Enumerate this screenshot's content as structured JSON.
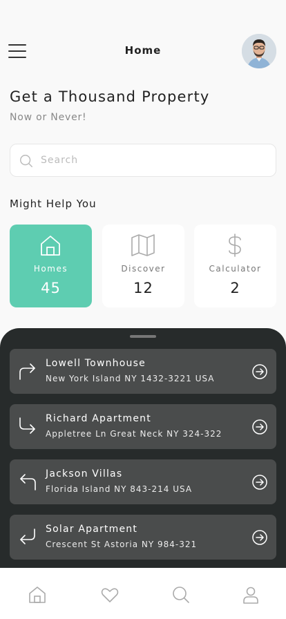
{
  "header": {
    "title": "Home",
    "menu_icon": "hamburger-icon",
    "avatar": "user-avatar"
  },
  "hero": {
    "title": "Get a Thousand Property",
    "subtitle": "Now or Never!"
  },
  "search": {
    "placeholder": "Search",
    "icon": "search-icon"
  },
  "help": {
    "title": "Might Help You",
    "cards": [
      {
        "label": "Homes",
        "value": "45",
        "icon": "house-icon",
        "active": true
      },
      {
        "label": "Discover",
        "value": "12",
        "icon": "map-icon",
        "active": false
      },
      {
        "label": "Calculator",
        "value": "2",
        "icon": "dollar-icon",
        "active": false
      }
    ]
  },
  "properties": [
    {
      "name": "Lowell Townhouse",
      "address": "New York Island NY 1432-3221 USA",
      "icon": "turn-right-up-icon"
    },
    {
      "name": "Richard Apartment",
      "address": "Appletree Ln Great Neck NY 324-322",
      "icon": "turn-down-right-icon"
    },
    {
      "name": "Jackson Villas",
      "address": "Florida Island NY 843-214 USA",
      "icon": "turn-left-up-icon"
    },
    {
      "name": "Solar Apartment",
      "address": "Crescent St Astoria NY 984-321",
      "icon": "return-left-icon"
    }
  ],
  "tabbar": {
    "items": [
      "home-tab",
      "favorites-tab",
      "search-tab",
      "profile-tab"
    ]
  },
  "colors": {
    "accent": "#5ecdb1",
    "sheet": "#272b2b",
    "item": "#4a4c4c",
    "background": "#f9f9f9"
  }
}
